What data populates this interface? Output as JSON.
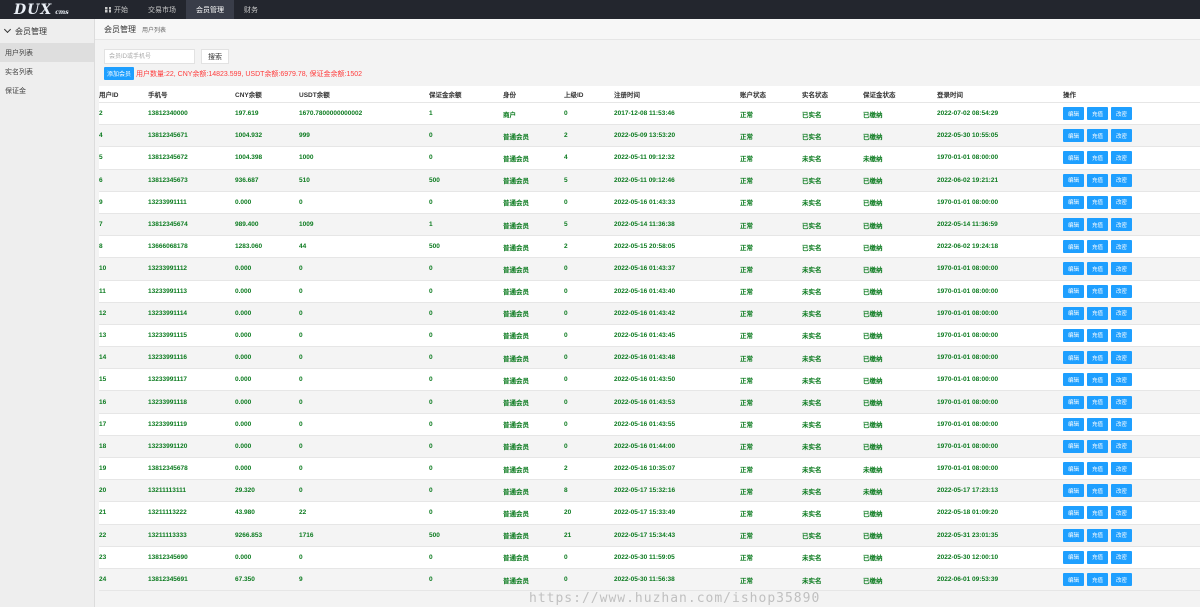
{
  "logo": {
    "main": "DUX",
    "sub": "cms"
  },
  "topnav": [
    {
      "label": "开始",
      "icon": "windows-icon"
    },
    {
      "label": "交易市场"
    },
    {
      "label": "会员管理",
      "active": true
    },
    {
      "label": "财务"
    }
  ],
  "sidebar": {
    "section": "会员管理",
    "items": [
      {
        "label": "用户列表",
        "active": true
      },
      {
        "label": "实名列表"
      },
      {
        "label": "保证金"
      }
    ]
  },
  "page": {
    "title": "会员管理",
    "subtitle": "用户列表"
  },
  "search": {
    "placeholder": "会员ID或手机号",
    "value": "",
    "button": "搜索"
  },
  "add_button": "添加会员",
  "summary": "用户数量:22, CNY余额:14823.599, USDT余额:6979.78, 保证金余额:1502",
  "colors": {
    "accent": "#1e9fff",
    "value_text": "#0a7a1e",
    "summary": "#ff3b3b",
    "topbar": "#23262e"
  },
  "table": {
    "headers": [
      "用户ID",
      "手机号",
      "CNY余额",
      "USDT余额",
      "保证金余额",
      "身份",
      "上级ID",
      "注册时间",
      "账户状态",
      "实名状态",
      "保证金状态",
      "登录时间",
      "操作"
    ],
    "actions": [
      "编辑",
      "充值",
      "改密"
    ],
    "rows": [
      [
        "2",
        "13812340000",
        "197.619",
        "1670.7800000000002",
        "1",
        "商户",
        "0",
        "2017-12-08 11:53:46",
        "正常",
        "已实名",
        "已缴纳",
        "2022-07-02 08:54:29"
      ],
      [
        "4",
        "13812345671",
        "1004.932",
        "999",
        "0",
        "普通会员",
        "2",
        "2022-05-09 13:53:20",
        "正常",
        "已实名",
        "已缴纳",
        "2022-05-30 10:55:05"
      ],
      [
        "5",
        "13812345672",
        "1004.398",
        "1000",
        "0",
        "普通会员",
        "4",
        "2022-05-11 09:12:32",
        "正常",
        "未实名",
        "未缴纳",
        "1970-01-01 08:00:00"
      ],
      [
        "6",
        "13812345673",
        "936.687",
        "510",
        "500",
        "普通会员",
        "5",
        "2022-05-11 09:12:46",
        "正常",
        "已实名",
        "已缴纳",
        "2022-06-02 19:21:21"
      ],
      [
        "9",
        "13233991111",
        "0.000",
        "0",
        "0",
        "普通会员",
        "0",
        "2022-05-16 01:43:33",
        "正常",
        "未实名",
        "已缴纳",
        "1970-01-01 08:00:00"
      ],
      [
        "7",
        "13812345674",
        "989.400",
        "1009",
        "1",
        "普通会员",
        "5",
        "2022-05-14 11:36:38",
        "正常",
        "已实名",
        "已缴纳",
        "2022-05-14 11:36:59"
      ],
      [
        "8",
        "13666068178",
        "1283.060",
        "44",
        "500",
        "普通会员",
        "2",
        "2022-05-15 20:58:05",
        "正常",
        "已实名",
        "已缴纳",
        "2022-06-02 19:24:18"
      ],
      [
        "10",
        "13233991112",
        "0.000",
        "0",
        "0",
        "普通会员",
        "0",
        "2022-05-16 01:43:37",
        "正常",
        "未实名",
        "已缴纳",
        "1970-01-01 08:00:00"
      ],
      [
        "11",
        "13233991113",
        "0.000",
        "0",
        "0",
        "普通会员",
        "0",
        "2022-05-16 01:43:40",
        "正常",
        "未实名",
        "已缴纳",
        "1970-01-01 08:00:00"
      ],
      [
        "12",
        "13233991114",
        "0.000",
        "0",
        "0",
        "普通会员",
        "0",
        "2022-05-16 01:43:42",
        "正常",
        "未实名",
        "已缴纳",
        "1970-01-01 08:00:00"
      ],
      [
        "13",
        "13233991115",
        "0.000",
        "0",
        "0",
        "普通会员",
        "0",
        "2022-05-16 01:43:45",
        "正常",
        "未实名",
        "已缴纳",
        "1970-01-01 08:00:00"
      ],
      [
        "14",
        "13233991116",
        "0.000",
        "0",
        "0",
        "普通会员",
        "0",
        "2022-05-16 01:43:48",
        "正常",
        "未实名",
        "已缴纳",
        "1970-01-01 08:00:00"
      ],
      [
        "15",
        "13233991117",
        "0.000",
        "0",
        "0",
        "普通会员",
        "0",
        "2022-05-16 01:43:50",
        "正常",
        "未实名",
        "已缴纳",
        "1970-01-01 08:00:00"
      ],
      [
        "16",
        "13233991118",
        "0.000",
        "0",
        "0",
        "普通会员",
        "0",
        "2022-05-16 01:43:53",
        "正常",
        "未实名",
        "已缴纳",
        "1970-01-01 08:00:00"
      ],
      [
        "17",
        "13233991119",
        "0.000",
        "0",
        "0",
        "普通会员",
        "0",
        "2022-05-16 01:43:55",
        "正常",
        "未实名",
        "已缴纳",
        "1970-01-01 08:00:00"
      ],
      [
        "18",
        "13233991120",
        "0.000",
        "0",
        "0",
        "普通会员",
        "0",
        "2022-05-16 01:44:00",
        "正常",
        "未实名",
        "已缴纳",
        "1970-01-01 08:00:00"
      ],
      [
        "19",
        "13812345678",
        "0.000",
        "0",
        "0",
        "普通会员",
        "2",
        "2022-05-16 10:35:07",
        "正常",
        "未实名",
        "未缴纳",
        "1970-01-01 08:00:00"
      ],
      [
        "20",
        "13211113111",
        "29.320",
        "0",
        "0",
        "普通会员",
        "8",
        "2022-05-17 15:32:16",
        "正常",
        "未实名",
        "未缴纳",
        "2022-05-17 17:23:13"
      ],
      [
        "21",
        "13211113222",
        "43.980",
        "22",
        "0",
        "普通会员",
        "20",
        "2022-05-17 15:33:49",
        "正常",
        "未实名",
        "已缴纳",
        "2022-05-18 01:09:20"
      ],
      [
        "22",
        "13211113333",
        "9266.853",
        "1716",
        "500",
        "普通会员",
        "21",
        "2022-05-17 15:34:43",
        "正常",
        "已实名",
        "已缴纳",
        "2022-05-31 23:01:35"
      ],
      [
        "23",
        "13812345690",
        "0.000",
        "0",
        "0",
        "普通会员",
        "0",
        "2022-05-30 11:59:05",
        "正常",
        "未实名",
        "已缴纳",
        "2022-05-30 12:00:10"
      ],
      [
        "24",
        "13812345691",
        "67.350",
        "9",
        "0",
        "普通会员",
        "0",
        "2022-05-30 11:56:38",
        "正常",
        "未实名",
        "已缴纳",
        "2022-06-01 09:53:39"
      ]
    ]
  },
  "watermark": "https://www.huzhan.com/ishop35890"
}
